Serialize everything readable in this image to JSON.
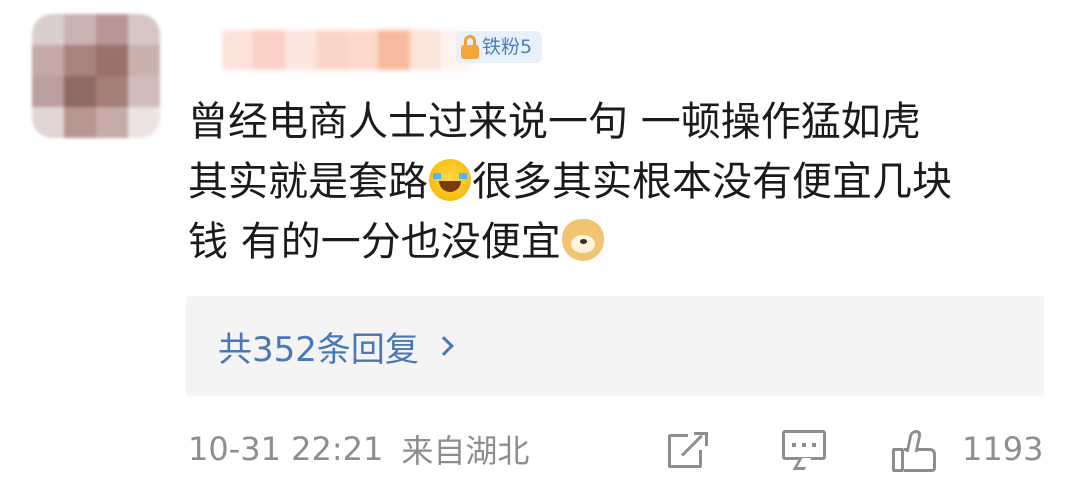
{
  "user": {
    "badge_label": "铁粉5"
  },
  "comment": {
    "line1": "曾经电商人士过来说一句 一顿操作猛如虎",
    "line2_part1": "其实就是套路",
    "line2_part2": "很多其实根本没有便宜几块",
    "line3": "钱 有的一分也没便宜",
    "emoji_1": "laugh-cry-emoji",
    "emoji_2": "doge-emoji"
  },
  "replies": {
    "label": "共352条回复"
  },
  "footer": {
    "timestamp": "10-31 22:21",
    "location": "来自湖北",
    "like_count": "1193"
  },
  "colors": {
    "link_blue": "#4a77b5",
    "meta_gray": "#8e8e8e",
    "reply_bg": "#f4f4f5"
  }
}
